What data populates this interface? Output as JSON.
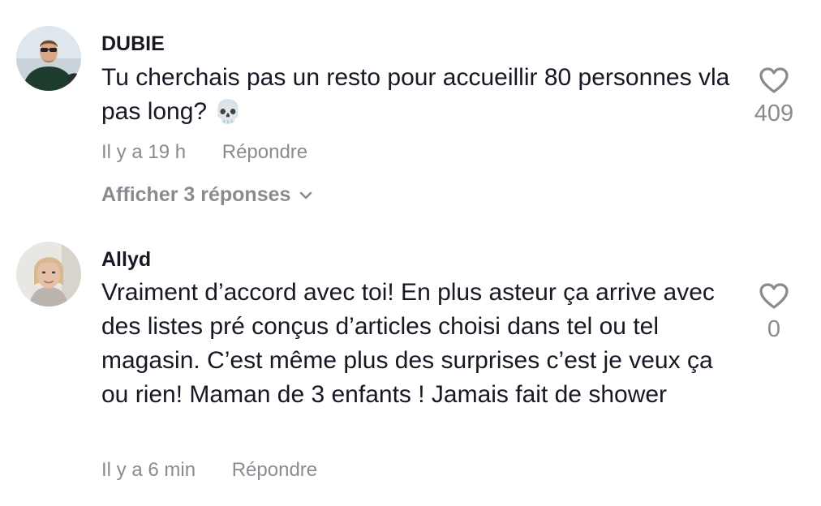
{
  "comments": [
    {
      "username": "DUBIE",
      "text": "Tu cherchais pas un resto pour accueillir 80 personnes vla pas long?",
      "emoji": "💀",
      "timestamp": "Il y a 19 h",
      "reply_label": "Répondre",
      "likes": "409",
      "view_replies": "Afficher 3 réponses"
    },
    {
      "username": "Allyd",
      "text": "Vraiment d’accord avec toi! En plus asteur ça arrive avec des listes pré conçus d’articles choisi dans tel ou tel magasin. C’est même plus des surprises c’est je veux ça ou rien! Maman de 3 enfants ! Jamais fait de shower",
      "timestamp": "Il y a 6 min",
      "reply_label": "Répondre",
      "likes": "0"
    }
  ],
  "icons": {
    "like": "heart-outline-icon",
    "expand": "chevron-down-icon",
    "emoji": "skull-emoji"
  },
  "colors": {
    "text": "#161823",
    "secondary": "#8a8b91"
  }
}
